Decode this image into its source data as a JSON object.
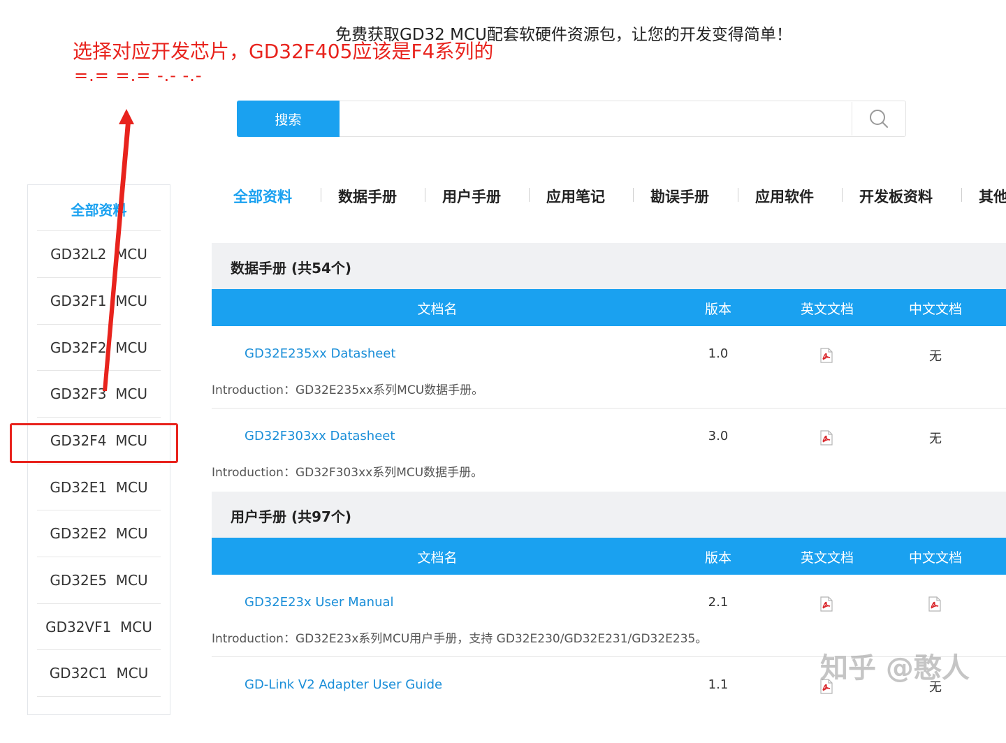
{
  "banner": {
    "slogan": "免费获取GD32 MCU配套软硬件资源包，让您的开发变得简单！"
  },
  "annotation": {
    "line1": "选择对应开发芯片，GD32F405应该是F4系列的",
    "line2": "=.=   =.= -.- -.-",
    "color": "#e8231d"
  },
  "search": {
    "button_label": "搜索",
    "placeholder": ""
  },
  "sidebar": {
    "title": "全部资料",
    "items": [
      "GD32L2  MCU",
      "GD32F1  MCU",
      "GD32F2  MCU",
      "GD32F3  MCU",
      "GD32F4  MCU",
      "GD32E1  MCU",
      "GD32E2  MCU",
      "GD32E5  MCU",
      "GD32VF1  MCU",
      "GD32C1  MCU"
    ]
  },
  "tabs": [
    "全部资料",
    "数据手册",
    "用户手册",
    "应用笔记",
    "勘误手册",
    "应用软件",
    "开发板资料",
    "其他"
  ],
  "table_columns": {
    "name": "文档名",
    "version": "版本",
    "en": "英文文档",
    "cn": "中文文档"
  },
  "sections": [
    {
      "title": "数据手册 (共54个)",
      "rows": [
        {
          "name": "GD32E235xx Datasheet",
          "version": "1.0",
          "en": "pdf",
          "cn": "无",
          "intro": "Introduction：GD32E235xx系列MCU数据手册。"
        },
        {
          "name": "GD32F303xx Datasheet",
          "version": "3.0",
          "en": "pdf",
          "cn": "无",
          "intro": "Introduction：GD32F303xx系列MCU数据手册。"
        }
      ]
    },
    {
      "title": "用户手册 (共97个)",
      "rows": [
        {
          "name": "GD32E23x User Manual",
          "version": "2.1",
          "en": "pdf",
          "cn": "pdf",
          "intro": "Introduction：GD32E23x系列MCU用户手册，支持 GD32E230/GD32E231/GD32E235。"
        },
        {
          "name": "GD-Link V2 Adapter User Guide",
          "version": "1.1",
          "en": "pdf",
          "cn": "无",
          "intro": ""
        }
      ]
    }
  ],
  "watermark": "知乎 @憨人",
  "colors": {
    "accent": "#1aa1f0",
    "link": "#1a8ed8",
    "annotation": "#e8231d"
  }
}
